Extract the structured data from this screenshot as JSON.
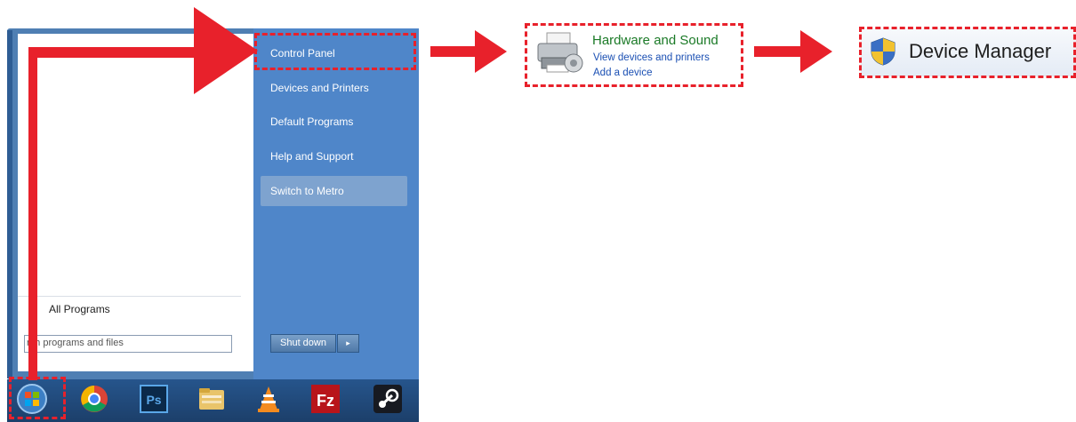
{
  "start_menu": {
    "right_items": [
      {
        "label": "Control Panel"
      },
      {
        "label": "Devices and Printers"
      },
      {
        "label": "Default Programs"
      },
      {
        "label": "Help and Support"
      },
      {
        "label": "Switch to Metro"
      }
    ],
    "all_programs": "All Programs",
    "search_placeholder": "rch programs and files",
    "shutdown_label": "Shut down",
    "shutdown_arrow": "▸"
  },
  "taskbar": {
    "icons": [
      "windows-start-icon",
      "chrome-icon",
      "photoshop-icon",
      "file-explorer-icon",
      "vlc-icon",
      "filezilla-icon",
      "steam-icon"
    ],
    "photoshop_text": "Ps",
    "filezilla_text": "Fz"
  },
  "control_panel_section": {
    "title": "Hardware and Sound",
    "links": [
      "View devices and printers",
      "Add a device"
    ]
  },
  "device_manager": {
    "label": "Device Manager"
  },
  "colors": {
    "annotation_red": "#e8212b",
    "start_menu_blue": "#4f86c9",
    "taskbar_blue": "#1c3f6a",
    "link_blue": "#1a4fb3",
    "section_green": "#1b7a27"
  }
}
